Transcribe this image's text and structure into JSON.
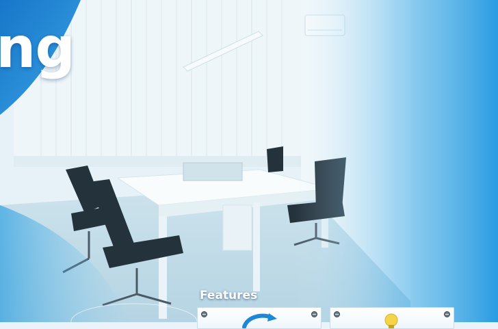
{
  "hero": {
    "headline": "ng",
    "scene": "office-photo"
  },
  "features": {
    "label": "Features",
    "cards": [
      {
        "icon": "refresh-arrow-icon"
      },
      {
        "icon": "lightbulb-icon"
      }
    ]
  },
  "colors": {
    "accent_blue": "#1e88d8",
    "text_white": "#ffffff"
  }
}
